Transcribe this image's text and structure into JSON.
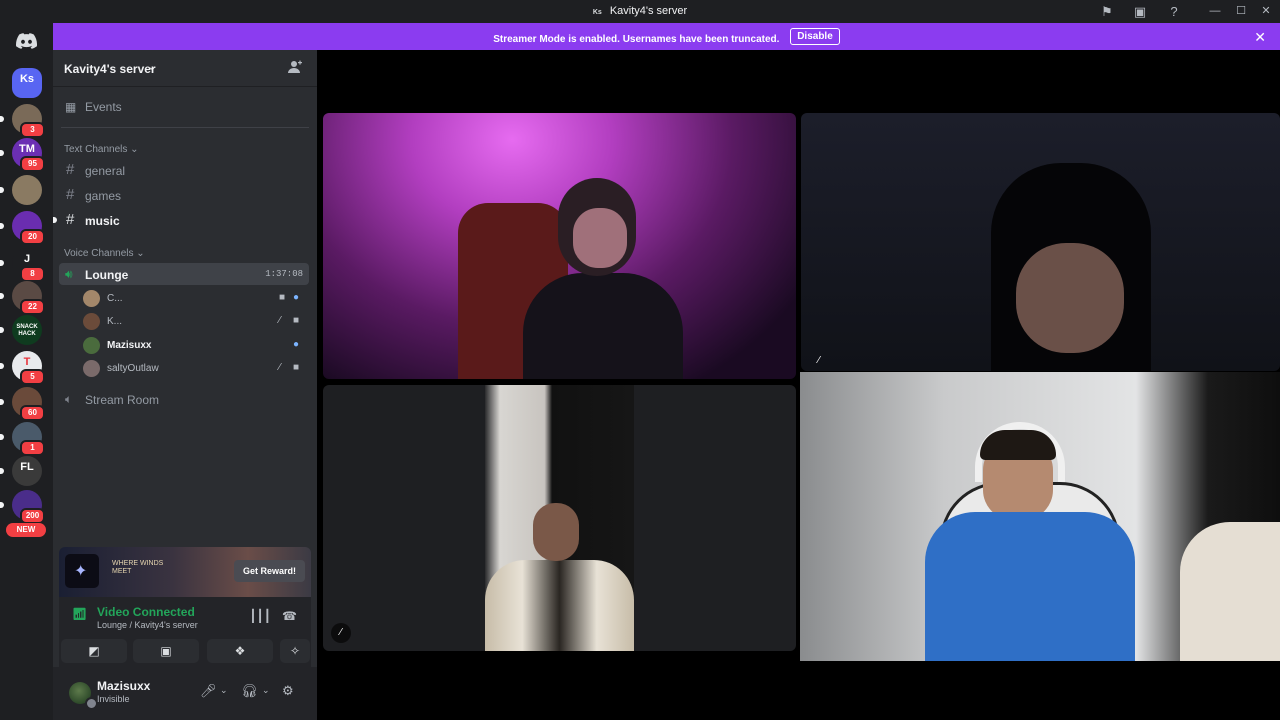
{
  "titlebar": {
    "app_logo_text": "Ks",
    "title": "Kavity4's server"
  },
  "banner": {
    "message": "Streamer Mode is enabled. Usernames have been truncated.",
    "disable_label": "Disable"
  },
  "rail": {
    "items": [
      {
        "label": "Ks",
        "badge": "",
        "color": "#5865f2"
      },
      {
        "label": "",
        "badge": "3",
        "color": "#7a6a58"
      },
      {
        "label": "TM",
        "badge": "95",
        "color": "#6b2fb3"
      },
      {
        "label": "",
        "badge": "",
        "color": "#8a7a62"
      },
      {
        "label": "",
        "badge": "20",
        "color": "#6a2db0"
      },
      {
        "label": "J",
        "badge": "8",
        "color": "#1e1f22"
      },
      {
        "label": "",
        "badge": "22",
        "color": "#5a4a44"
      },
      {
        "label": "SNACK HACK",
        "badge": "",
        "color": "#0f3b1f"
      },
      {
        "label": "T",
        "badge": "5",
        "color": "#e8eaed"
      },
      {
        "label": "",
        "badge": "60",
        "color": "#6a4a3a"
      },
      {
        "label": "",
        "badge": "1",
        "color": "#4a5a6a"
      },
      {
        "label": "FL",
        "badge": "",
        "color": "#3a3a3a"
      },
      {
        "label": "",
        "badge": "200",
        "color": "#4a2d8a"
      }
    ],
    "new_label": "NEW"
  },
  "sidebar": {
    "server_name": "Kavity4's server",
    "events_label": "Events",
    "text_category": "Text Channels",
    "text_channels": [
      {
        "name": "general"
      },
      {
        "name": "games"
      },
      {
        "name": "music"
      }
    ],
    "voice_category": "Voice Channels",
    "voice_channels": [
      {
        "name": "Lounge",
        "timer": "1:37:08"
      },
      {
        "name": "Stream Room"
      }
    ],
    "voice_users": [
      {
        "name": "C...",
        "color": "#a3876a"
      },
      {
        "name": "K...",
        "color": "#6b4b3a"
      },
      {
        "name": "Mazisuxx",
        "color": "#4a6b3d"
      },
      {
        "name": "saltyOutlaw",
        "color": "#7a6a6a"
      }
    ]
  },
  "promo": {
    "game_text": "WHERE WINDS MEET",
    "button_label": "Get Reward!"
  },
  "voice_panel": {
    "status": "Video Connected",
    "location": "Lounge / Kavity4's server"
  },
  "user_panel": {
    "username": "Mazisuxx",
    "status": "Invisible"
  },
  "colors": {
    "accent": "#8b3cf0",
    "connected": "#23a55a",
    "badge": "#f23f43"
  }
}
